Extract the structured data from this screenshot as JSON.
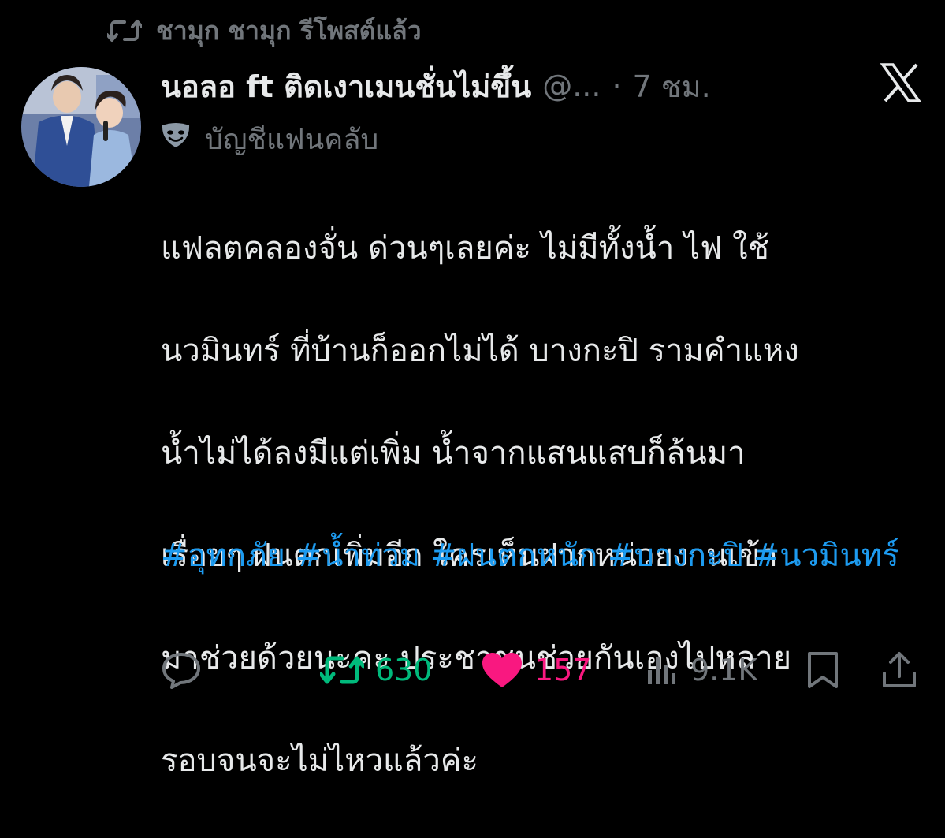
{
  "repost": {
    "text": "ชามุก ชามุก รีโพสต์แล้ว"
  },
  "author": {
    "display_name": "นอลอ ft ติดเงาเมนชั่นไม่ขึ้น",
    "handle": "@...",
    "separator": "·",
    "time": "7 ชม.",
    "badge_label": "บัญชีแฟนคลับ"
  },
  "tweet": {
    "lines": [
      "แฟลตคลองจั่น ด่วนๆเลยค่ะ ไม่มีทั้งน้ำ ไฟ ใช้",
      "นวมินทร์ ที่บ้านก็ออกไม่ได้ บางกะปิ รามคำแหง",
      "น้ำไม่ได้ลงมีแต่เพิ่ม น้ำจากแสนแสบก็ล้นมา",
      "เรื่อยๆ ฝนตกเพิ่มอีก ใครเห็นฝากหน่วยงานเข้า",
      "มาช่วยด้วยนะคะ ประชาชนช่วยกันเองไปหลาย",
      "รอบจนจะไม่ไหวแล้วค่ะ"
    ],
    "hashtags": [
      "#อุทกภัย",
      "#น้ำท่วม",
      "#ฝนตกหนัก",
      "#บางกะปิ",
      "#นวมินทร์"
    ]
  },
  "actions": {
    "retweets": "630",
    "likes": "157",
    "views": "9.1K"
  },
  "icons": {
    "repost": "repost-icon",
    "badge": "theater-mask-icon",
    "brand": "x-logo-icon",
    "reply": "reply-icon",
    "retweet": "retweet-icon",
    "like": "heart-icon",
    "views": "views-icon",
    "bookmark": "bookmark-icon",
    "share": "share-icon"
  },
  "colors": {
    "background": "#000000",
    "text": "#e7e9ea",
    "muted": "#71767b",
    "link": "#1d9bf0",
    "retweet_active": "#00ba7c",
    "like_active": "#f91880"
  }
}
